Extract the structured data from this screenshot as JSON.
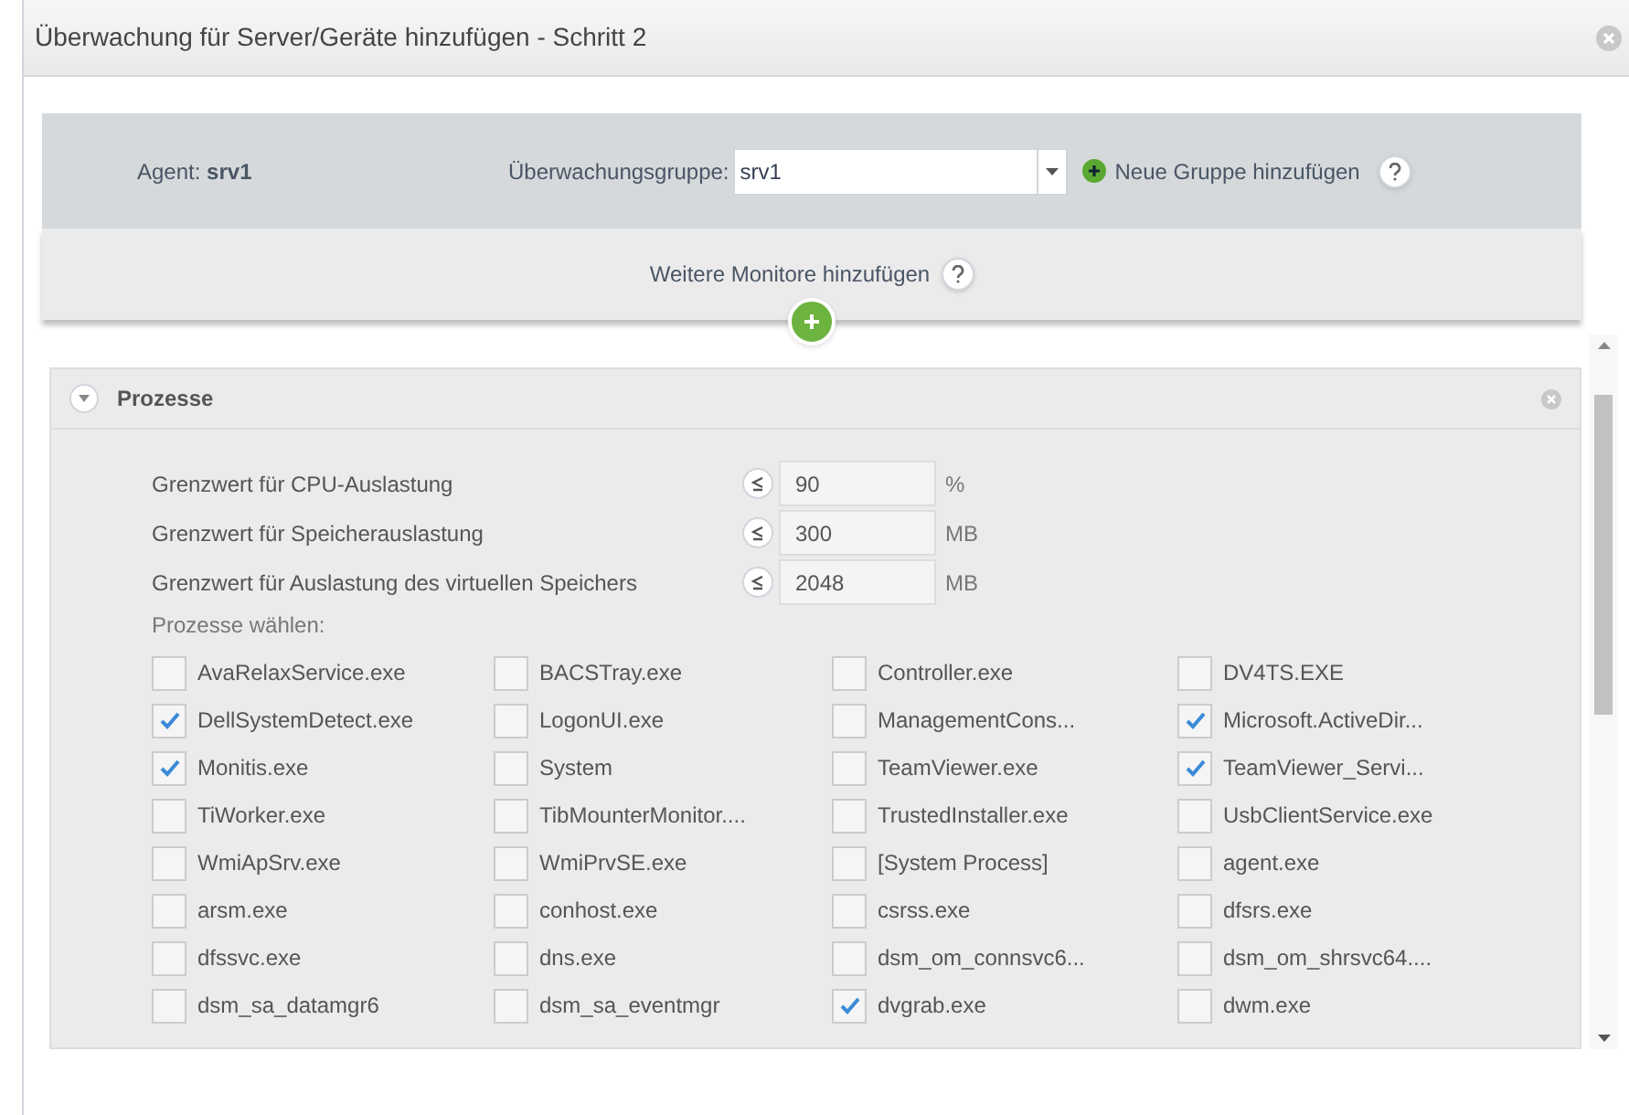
{
  "window": {
    "title": "Überwachung für Server/Geräte hinzufügen - Schritt 2"
  },
  "agent": {
    "label": "Agent:",
    "value": "srv1"
  },
  "group": {
    "label": "Überwachungsgruppe:",
    "value": "srv1",
    "add_label": "Neue Gruppe hinzufügen"
  },
  "more_monitors": {
    "label": "Weitere Monitore hinzufügen"
  },
  "section": {
    "title": "Prozesse",
    "expanded": true,
    "thresholds": [
      {
        "label": "Grenzwert für CPU-Auslastung",
        "value": "90",
        "unit": "%"
      },
      {
        "label": "Grenzwert für Speicherauslastung",
        "value": "300",
        "unit": "MB"
      },
      {
        "label": "Grenzwert für Auslastung des virtuellen Speichers",
        "value": "2048",
        "unit": "MB"
      }
    ],
    "process_label": "Prozesse wählen:",
    "processes": [
      {
        "name": "AvaRelaxService.exe",
        "checked": false
      },
      {
        "name": "BACSTray.exe",
        "checked": false
      },
      {
        "name": "Controller.exe",
        "checked": false
      },
      {
        "name": "DV4TS.EXE",
        "checked": false
      },
      {
        "name": "DellSystemDetect.exe",
        "checked": true
      },
      {
        "name": "LogonUI.exe",
        "checked": false
      },
      {
        "name": "ManagementCons...",
        "checked": false
      },
      {
        "name": "Microsoft.ActiveDir...",
        "checked": true
      },
      {
        "name": "Monitis.exe",
        "checked": true
      },
      {
        "name": "System",
        "checked": false
      },
      {
        "name": "TeamViewer.exe",
        "checked": false
      },
      {
        "name": "TeamViewer_Servi...",
        "checked": true
      },
      {
        "name": "TiWorker.exe",
        "checked": false
      },
      {
        "name": "TibMounterMonitor....",
        "checked": false
      },
      {
        "name": "TrustedInstaller.exe",
        "checked": false
      },
      {
        "name": "UsbClientService.exe",
        "checked": false
      },
      {
        "name": "WmiApSrv.exe",
        "checked": false
      },
      {
        "name": "WmiPrvSE.exe",
        "checked": false
      },
      {
        "name": "[System Process]",
        "checked": false
      },
      {
        "name": "agent.exe",
        "checked": false
      },
      {
        "name": "arsm.exe",
        "checked": false
      },
      {
        "name": "conhost.exe",
        "checked": false
      },
      {
        "name": "csrss.exe",
        "checked": false
      },
      {
        "name": "dfsrs.exe",
        "checked": false
      },
      {
        "name": "dfssvc.exe",
        "checked": false
      },
      {
        "name": "dns.exe",
        "checked": false
      },
      {
        "name": "dsm_om_connsvc6...",
        "checked": false
      },
      {
        "name": "dsm_om_shrsvc64....",
        "checked": false
      },
      {
        "name": "dsm_sa_datamgr6",
        "checked": false
      },
      {
        "name": "dsm_sa_eventmgr",
        "checked": false
      },
      {
        "name": "dvgrab.exe",
        "checked": true
      },
      {
        "name": "dwm.exe",
        "checked": false
      }
    ]
  }
}
